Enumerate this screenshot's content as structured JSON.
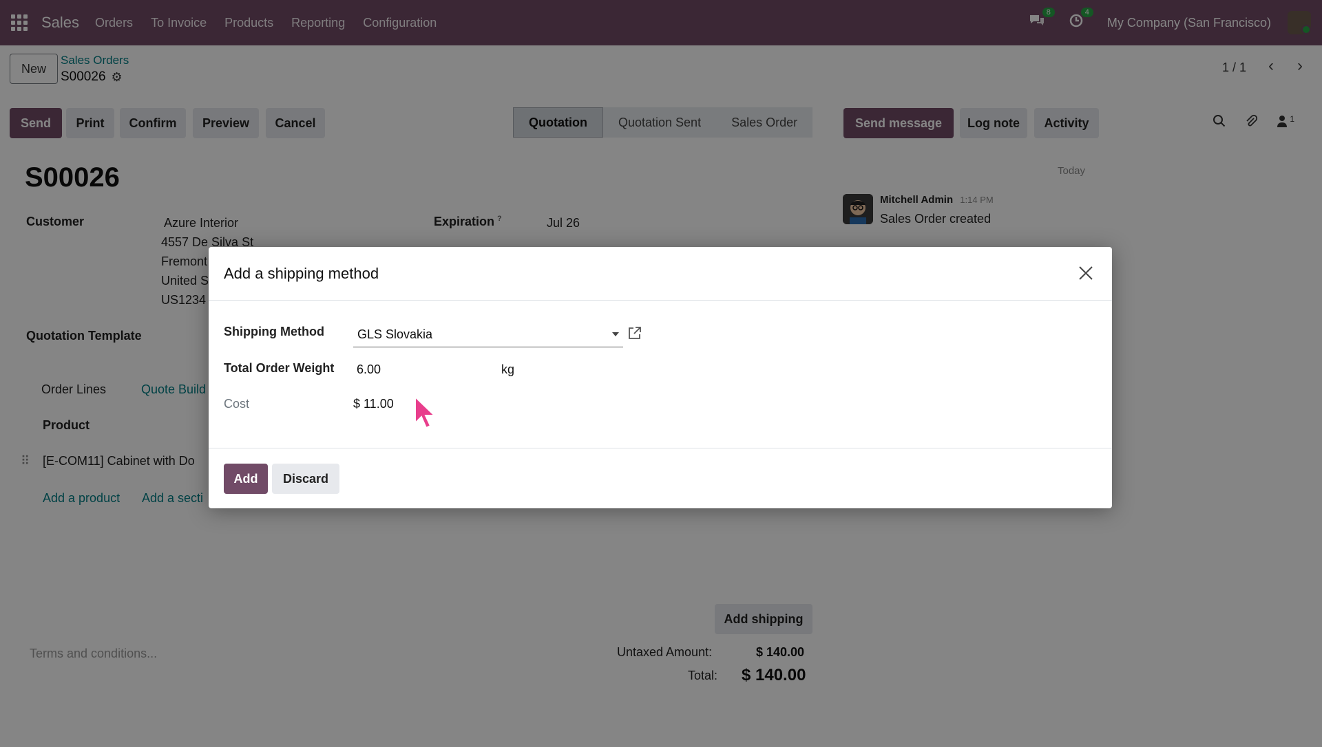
{
  "navbar": {
    "app_name": "Sales",
    "menu": [
      "Orders",
      "To Invoice",
      "Products",
      "Reporting",
      "Configuration"
    ],
    "messages_count": "8",
    "activities_count": "4",
    "company": "My Company (San Francisco)"
  },
  "control_panel": {
    "new_label": "New",
    "breadcrumb": "Sales Orders",
    "record_name": "S00026",
    "pager": "1 / 1",
    "buttons": {
      "send": "Send",
      "print": "Print",
      "confirm": "Confirm",
      "preview": "Preview",
      "cancel": "Cancel"
    },
    "stages": [
      "Quotation",
      "Quotation Sent",
      "Sales Order"
    ],
    "chatter_buttons": {
      "send_message": "Send message",
      "log_note": "Log note",
      "activity": "Activity"
    },
    "followers_count": "1"
  },
  "form": {
    "title": "S00026",
    "customer_label": "Customer",
    "customer_name": "Azure Interior",
    "address_lines": [
      "4557 De Silva St",
      "Fremont",
      "United S",
      "US1234"
    ],
    "expiration_label": "Expiration",
    "expiration_help": "?",
    "expiration_value": "Jul 26",
    "quotation_template_label": "Quotation Template",
    "tabs": [
      "Order Lines",
      "Quote Build"
    ],
    "product_header": "Product",
    "line_product": "[E-COM11] Cabinet with Do",
    "add_product": "Add a product",
    "add_section": "Add a secti",
    "add_shipping": "Add shipping",
    "terms_placeholder": "Terms and conditions...",
    "untaxed_label": "Untaxed Amount:",
    "untaxed_value": "$ 140.00",
    "total_label": "Total:",
    "total_value": "$ 140.00"
  },
  "chatter": {
    "date_separator": "Today",
    "author": "Mitchell Admin",
    "time": "1:14 PM",
    "message": "Sales Order created"
  },
  "modal": {
    "title": "Add a shipping method",
    "shipping_method_label": "Shipping Method",
    "shipping_method_value": "GLS Slovakia",
    "weight_label": "Total Order Weight",
    "weight_value": "6.00",
    "weight_unit": "kg",
    "cost_label": "Cost",
    "cost_value": "$ 11.00",
    "add_label": "Add",
    "discard_label": "Discard"
  },
  "colors": {
    "brand": "#714b67",
    "link": "#017e84",
    "badge": "#28a745",
    "cursor": "#e83e8c"
  }
}
